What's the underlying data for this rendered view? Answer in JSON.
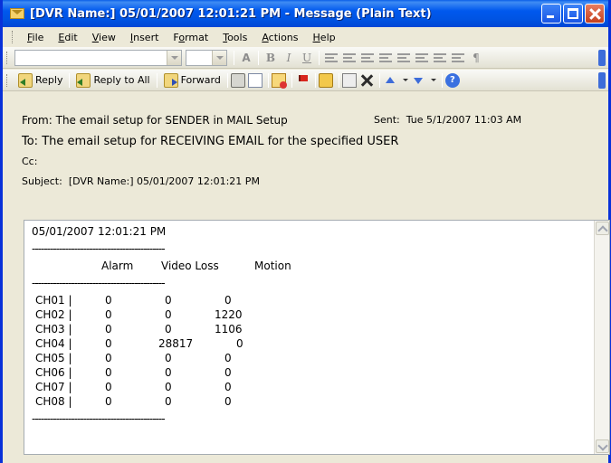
{
  "window": {
    "title": "[DVR Name:] 05/01/2007 12:01:21 PM  - Message (Plain Text)"
  },
  "menu": [
    {
      "label": "File",
      "accel": "F"
    },
    {
      "label": "Edit",
      "accel": "E"
    },
    {
      "label": "View",
      "accel": "V"
    },
    {
      "label": "Insert",
      "accel": "I"
    },
    {
      "label": "Format",
      "accel": "o"
    },
    {
      "label": "Tools",
      "accel": "T"
    },
    {
      "label": "Actions",
      "accel": "A"
    },
    {
      "label": "Help",
      "accel": "H"
    }
  ],
  "toolbar_format": {
    "font_value": "",
    "size_value": "",
    "bold": "B",
    "italic": "I",
    "underline": "U",
    "font_color": "A",
    "para": "¶"
  },
  "toolbar_actions": {
    "reply": "Reply",
    "reply_all": "Reply to All",
    "forward": "Forward"
  },
  "header": {
    "from_label": "From:",
    "from_value": "The email setup for SENDER in MAIL Setup",
    "sent_label": "Sent:",
    "sent_value": "Tue 5/1/2007 11:03 AM",
    "to_label": "To:",
    "to_value": "The email setup for RECEIVING EMAIL for the specified USER",
    "cc_label": "Cc:",
    "subject_label": "Subject:",
    "subject_value": "[DVR Name:] 05/01/2007 12:01:21 PM"
  },
  "body": {
    "timestamp": "05/01/2007 12:01:21 PM",
    "separator": "--------------------------------------------",
    "columns": [
      "Alarm",
      "Video Loss",
      "Motion"
    ],
    "rows": [
      {
        "channel": "CH01 |",
        "alarm": "0",
        "video_loss": "0",
        "motion": "0"
      },
      {
        "channel": "CH02 |",
        "alarm": "0",
        "video_loss": "0",
        "motion": "1220"
      },
      {
        "channel": "CH03 |",
        "alarm": "0",
        "video_loss": "0",
        "motion": "1106"
      },
      {
        "channel": "CH04 |",
        "alarm": "0",
        "video_loss": "28817",
        "motion": "0"
      },
      {
        "channel": "CH05 |",
        "alarm": "0",
        "video_loss": "0",
        "motion": "0"
      },
      {
        "channel": "CH06 |",
        "alarm": "0",
        "video_loss": "0",
        "motion": "0"
      },
      {
        "channel": "CH07 |",
        "alarm": "0",
        "video_loss": "0",
        "motion": "0"
      },
      {
        "channel": "CH08 |",
        "alarm": "0",
        "video_loss": "0",
        "motion": "0"
      }
    ]
  }
}
